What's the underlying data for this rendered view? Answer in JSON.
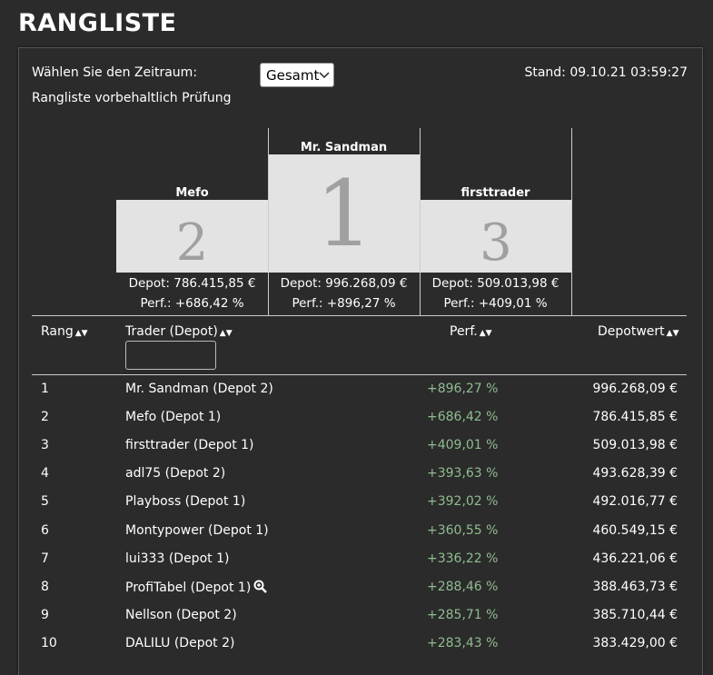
{
  "page": {
    "title": "RANGLISTE"
  },
  "controls": {
    "period_label": "Wählen Sie den Zeitraum:",
    "period_value": "Gesamt",
    "disclaimer": "Rangliste vorbehaltlich Prüfung",
    "stand": "Stand: 09.10.21 03:59:27"
  },
  "podium": {
    "first": {
      "place": "1",
      "name": "Mr. Sandman",
      "depot": "Depot: 996.268,09 €",
      "perf": "Perf.: +896,27 %"
    },
    "second": {
      "place": "2",
      "name": "Mefo",
      "depot": "Depot: 786.415,85 €",
      "perf": "Perf.: +686,42 %"
    },
    "third": {
      "place": "3",
      "name": "firsttrader",
      "depot": "Depot: 509.013,98 €",
      "perf": "Perf.: +409,01 %"
    }
  },
  "table": {
    "headers": {
      "rank": "Rang",
      "trader": "Trader (Depot)",
      "perf": "Perf.",
      "depot": "Depotwert"
    },
    "filter_value": "",
    "rows": [
      {
        "rank": "1",
        "trader": "Mr. Sandman (Depot 2)",
        "perf": "+896,27 %",
        "depot": "996.268,09 €"
      },
      {
        "rank": "2",
        "trader": "Mefo (Depot 1)",
        "perf": "+686,42 %",
        "depot": "786.415,85 €"
      },
      {
        "rank": "3",
        "trader": "firsttrader (Depot 1)",
        "perf": "+409,01 %",
        "depot": "509.013,98 €"
      },
      {
        "rank": "4",
        "trader": "adl75 (Depot 2)",
        "perf": "+393,63 %",
        "depot": "493.628,39 €"
      },
      {
        "rank": "5",
        "trader": "Playboss (Depot 1)",
        "perf": "+392,02 %",
        "depot": "492.016,77 €"
      },
      {
        "rank": "6",
        "trader": "Montypower (Depot 1)",
        "perf": "+360,55 %",
        "depot": "460.549,15 €"
      },
      {
        "rank": "7",
        "trader": "lui333 (Depot 1)",
        "perf": "+336,22 %",
        "depot": "436.221,06 €"
      },
      {
        "rank": "8",
        "trader": "ProfiTabel (Depot 1)",
        "perf": "+288,46 %",
        "depot": "388.463,73 €",
        "zoom_icon": "magnifier-plus-icon"
      },
      {
        "rank": "9",
        "trader": "Nellson (Depot 2)",
        "perf": "+285,71 %",
        "depot": "385.710,44 €"
      },
      {
        "rank": "10",
        "trader": "DALILU (Depot 2)",
        "perf": "+283,43 %",
        "depot": "383.429,00 €"
      }
    ]
  },
  "colors": {
    "background": "#2b2b2b",
    "podium_block": "#e3e3e3",
    "podium_digit": "#a0a0a0",
    "perf_positive": "#8fbc8f"
  }
}
